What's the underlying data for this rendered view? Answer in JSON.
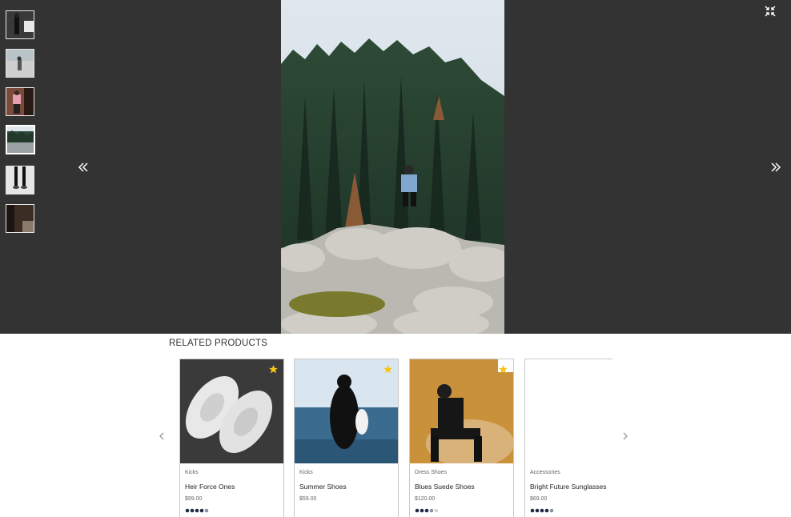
{
  "lightbox": {
    "thumbnails": [
      {
        "name": "thumb-1",
        "active": false
      },
      {
        "name": "thumb-2",
        "active": false
      },
      {
        "name": "thumb-3",
        "active": false
      },
      {
        "name": "thumb-4",
        "active": true
      },
      {
        "name": "thumb-5",
        "active": false
      },
      {
        "name": "thumb-6",
        "active": false
      }
    ],
    "prev_icon": "double-chevron-left-icon",
    "next_icon": "double-chevron-right-icon",
    "fullscreen_icon": "exit-fullscreen-icon"
  },
  "related": {
    "title": "RELATED PRODUCTS",
    "prev_icon": "chevron-left-icon",
    "next_icon": "chevron-right-icon",
    "products": [
      {
        "category": "Kicks",
        "name": "Heir Force Ones",
        "price": "$99.00",
        "rating": 4.5,
        "favorite": true
      },
      {
        "category": "Kicks",
        "name": "Summer Shoes",
        "price": "$59.00",
        "rating": 0,
        "favorite": true
      },
      {
        "category": "Dress Shoes",
        "name": "Blues Suede Shoes",
        "price": "$120.00",
        "rating": 3.5,
        "favorite": true
      },
      {
        "category": "Accessories",
        "name": "Bright Future Sunglasses",
        "price": "$69.00",
        "rating": 4.5,
        "favorite": false
      }
    ]
  },
  "colors": {
    "lightbox_bg": "#333333",
    "star_gold": "#f5c518",
    "rating_dark": "#1f2a44"
  }
}
